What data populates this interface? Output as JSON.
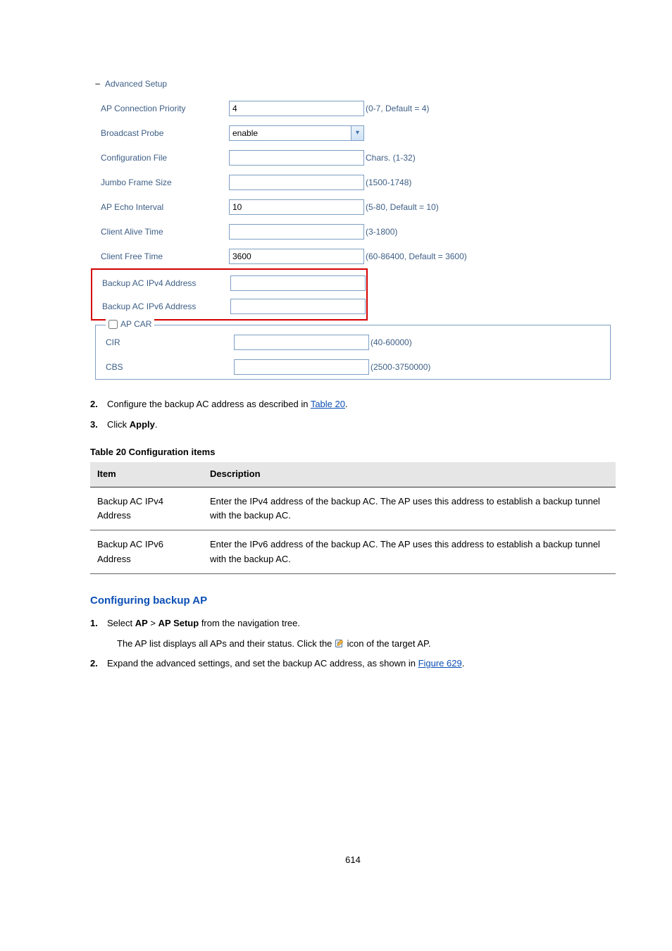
{
  "figure": {
    "section_title": "Advanced Setup",
    "rows": {
      "ap_priority": {
        "label": "AP Connection Priority",
        "value": "4",
        "hint": "(0-7, Default = 4)"
      },
      "broadcast_probe": {
        "label": "Broadcast Probe",
        "value": "enable"
      },
      "config_file": {
        "label": "Configuration File",
        "value": "",
        "hint": "Chars. (1-32)"
      },
      "jumbo": {
        "label": "Jumbo Frame Size",
        "value": "",
        "hint": "(1500-1748)"
      },
      "echo": {
        "label": "AP Echo Interval",
        "value": "10",
        "hint": "(5-80, Default = 10)"
      },
      "alive": {
        "label": "Client Alive Time",
        "value": "",
        "hint": "(3-1800)"
      },
      "free": {
        "label": "Client Free Time",
        "value": "3600",
        "hint": "(60-86400, Default = 3600)"
      },
      "backup4": {
        "label": "Backup AC IPv4 Address",
        "value": ""
      },
      "backup6": {
        "label": "Backup AC IPv6 Address",
        "value": ""
      }
    },
    "apcar": {
      "legend": "AP CAR",
      "cir": {
        "label": "CIR",
        "value": "",
        "hint": "(40-60000)"
      },
      "cbs": {
        "label": "CBS",
        "value": "",
        "hint": "(2500-3750000)"
      }
    }
  },
  "step2": {
    "num": "2.",
    "text_before": "Configure the backup AC address as described in ",
    "link": "Table 20",
    "text_after": "."
  },
  "step3": {
    "num": "3.",
    "text_before": "Click ",
    "bold": "Apply",
    "text_after": "."
  },
  "table": {
    "caption": "Table 20 Configuration items",
    "headers": {
      "item": "Item",
      "desc": "Description"
    },
    "rows": [
      {
        "item": "Backup AC IPv4 Address",
        "desc": "Enter the IPv4 address of the backup AC. The AP uses this address to establish a backup tunnel with the backup AC."
      },
      {
        "item": "Backup AC IPv6 Address",
        "desc": "Enter the IPv6 address of the backup AC. The AP uses this address to establish a backup tunnel with the backup AC."
      }
    ]
  },
  "section": {
    "title": "Configuring backup AP",
    "intro": {
      "num": "1.",
      "text_before_a": "Select ",
      "bold_a": "AP",
      "text_mid_a": " > ",
      "bold_b": "AP Setup",
      "text_after_a": " from the navigation tree.",
      "line2_before": "The AP list displays all APs and their status. Click the ",
      "line2_after": " icon of the target AP."
    },
    "step2": {
      "num": "2.",
      "text_before": "Expand the advanced settings, and set the backup AC address, as shown in ",
      "link": "Figure 629",
      "text_after": "."
    }
  },
  "page_number": "614"
}
